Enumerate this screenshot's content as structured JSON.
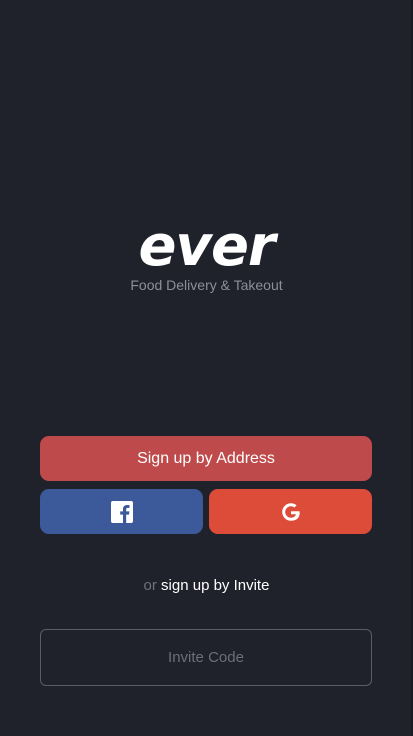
{
  "app": {
    "logo_text": "ever",
    "tagline": "Food Delivery & Takeout"
  },
  "auth": {
    "address_button_label": "Sign up by Address",
    "facebook_icon": "facebook-icon",
    "google_icon": "google-icon",
    "or_text": "or",
    "invite_link_label": "sign up by Invite",
    "invite_code_placeholder": "Invite Code",
    "invite_code_value": ""
  },
  "colors": {
    "background": "#20222b",
    "address_button": "#bf4a4b",
    "facebook": "#3c5a99",
    "google": "#dd4b39"
  }
}
